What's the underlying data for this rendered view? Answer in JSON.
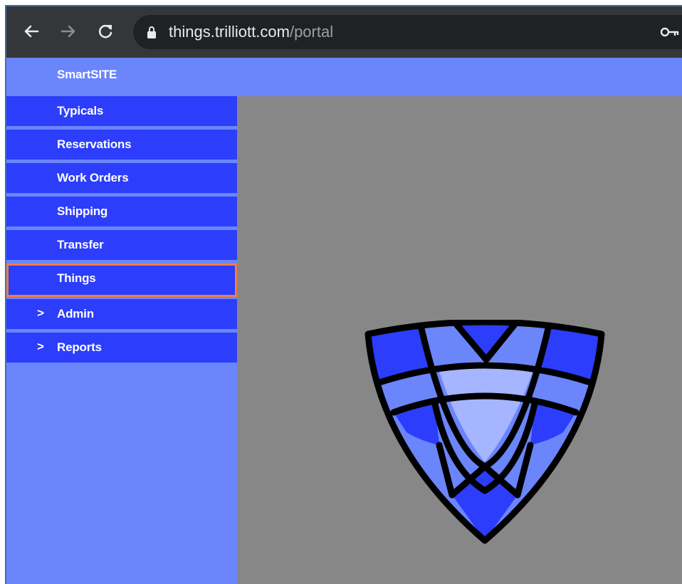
{
  "browser": {
    "url_host": "things.trilliott.com",
    "url_path": "/portal",
    "back_icon": "arrow-left-icon",
    "forward_icon": "arrow-right-icon",
    "reload_icon": "reload-icon",
    "lock_icon": "lock-icon",
    "key_icon": "key-icon"
  },
  "sidebar": {
    "brand": "SmartSITE",
    "items": [
      {
        "label": "Typicals"
      },
      {
        "label": "Reservations"
      },
      {
        "label": "Work Orders"
      },
      {
        "label": "Shipping"
      },
      {
        "label": "Transfer"
      },
      {
        "label": "Things",
        "highlighted": true
      },
      {
        "label": "Admin",
        "expandable": true,
        "chevron": ">"
      },
      {
        "label": "Reports",
        "expandable": true,
        "chevron": ">"
      }
    ]
  },
  "colors": {
    "sidebar_bg": "#6b85fb",
    "menu_item_bg": "#2c3dfc",
    "highlight_border": "#f07c42",
    "main_bg": "#878787",
    "chrome_bg": "#35363a"
  },
  "main": {
    "logo": "shield-logo"
  }
}
